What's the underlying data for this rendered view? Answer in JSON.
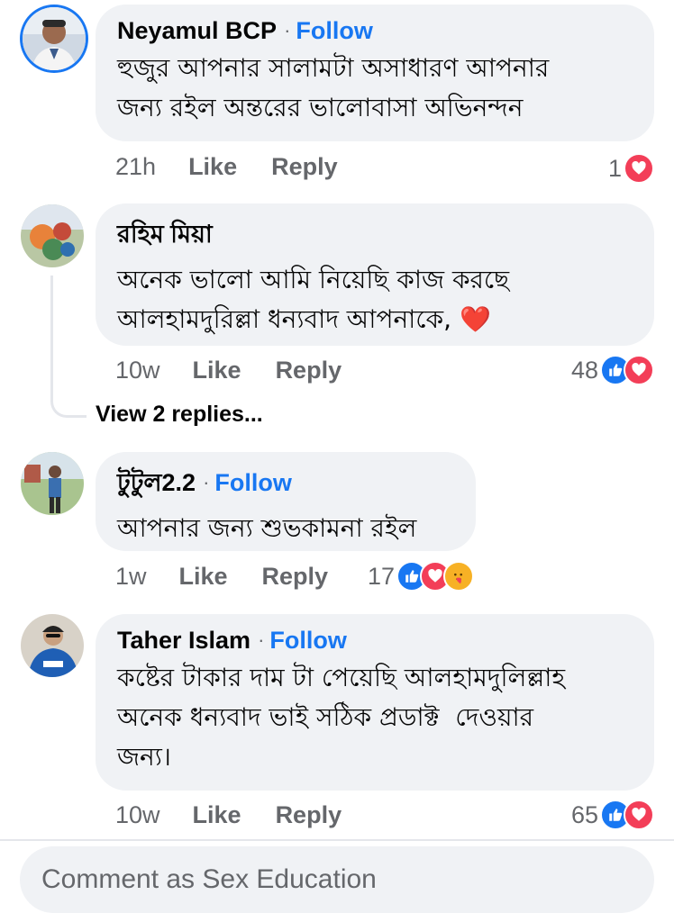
{
  "comments": [
    {
      "author": "Neyamul BCP",
      "follow": "Follow",
      "text_lines": [
        "হুজুর আপনার সালামটা অসাধারণ আপনার",
        "জন্য রইল অন্তরের ভালোবাসা অভিনন্দন"
      ],
      "time": "21h",
      "like": "Like",
      "reply": "Reply",
      "reaction_count": "1",
      "reactions": [
        "heart-icon"
      ]
    },
    {
      "author": "রহিম মিয়া",
      "text_lines": [
        "অনেক ভালো আমি নিয়েছি কাজ করছে",
        "আলহামদুরিল্লা ধন্যবাদ আপনাকে, ❤️"
      ],
      "time": "10w",
      "like": "Like",
      "reply": "Reply",
      "reaction_count": "48",
      "reactions": [
        "like-icon",
        "heart-icon"
      ],
      "view_replies": "View 2 replies..."
    },
    {
      "author": "টুটুল2.2",
      "follow": "Follow",
      "text_lines": [
        "আপনার জন্য শুভকামনা রইল"
      ],
      "time": "1w",
      "like": "Like",
      "reply": "Reply",
      "reaction_count": "17",
      "reactions": [
        "like-icon",
        "heart-icon",
        "care-icon"
      ]
    },
    {
      "author": "Taher Islam",
      "follow": "Follow",
      "text_lines": [
        "কষ্টের টাকার দাম টা পেয়েছি আলহামদুলিল্লাহ",
        "অনেক ধন্যবাদ ভাই সঠিক প্রডাক্ট  দেওয়ার",
        "জন্য।"
      ],
      "time": "10w",
      "like": "Like",
      "reply": "Reply",
      "reaction_count": "65",
      "reactions": [
        "like-icon",
        "heart-icon"
      ]
    }
  ],
  "composer": {
    "placeholder": "Comment as Sex Education"
  },
  "colors": {
    "brand": "#1877f2",
    "love": "#f33e58",
    "bubble": "#f0f2f5",
    "meta": "#65676b"
  }
}
